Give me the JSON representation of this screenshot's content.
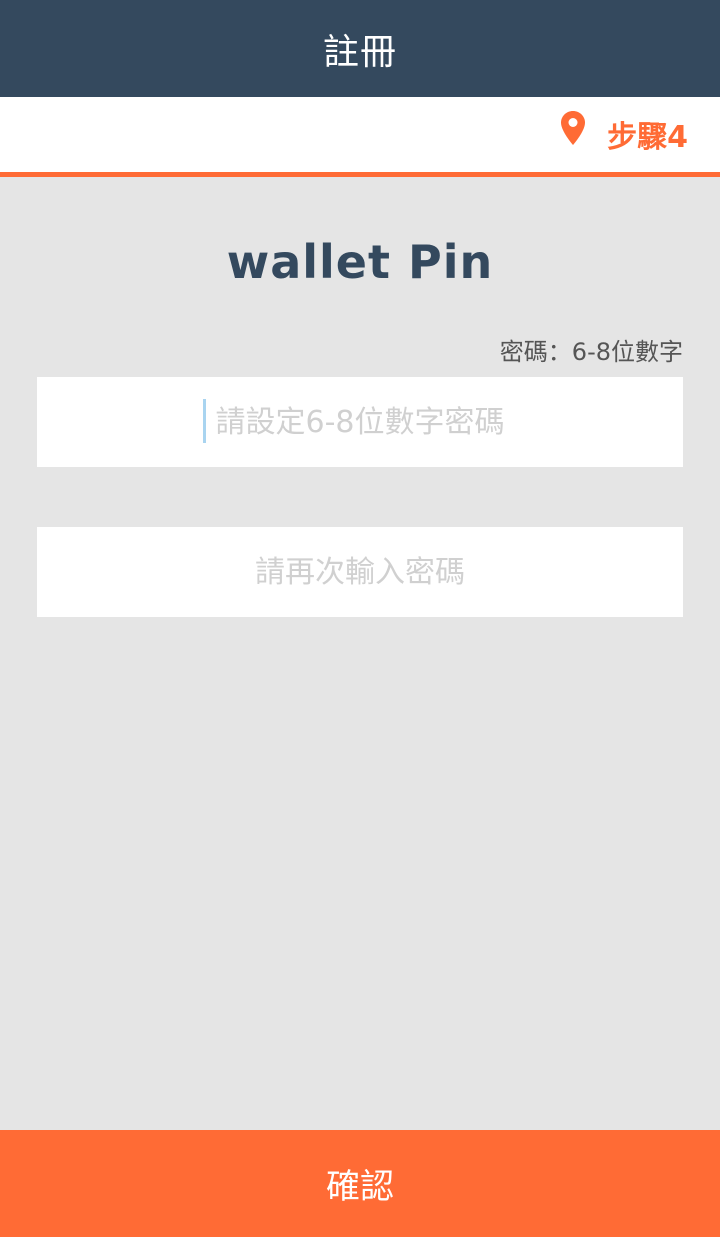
{
  "header": {
    "title": "註冊"
  },
  "step": {
    "icon": "map-pin-icon",
    "label": "步驟4"
  },
  "logo": {
    "text": "wallet Pin"
  },
  "password_hint": "密碼：6-8位數字",
  "fields": {
    "password": {
      "value": "",
      "placeholder": "請設定6-8位數字密碼"
    },
    "confirm_password": {
      "value": "",
      "placeholder": "請再次輸入密碼"
    }
  },
  "confirm_button": {
    "label": "確認"
  },
  "colors": {
    "header": "#34495e",
    "accent": "#ff6b35",
    "background": "#e5e5e5"
  }
}
